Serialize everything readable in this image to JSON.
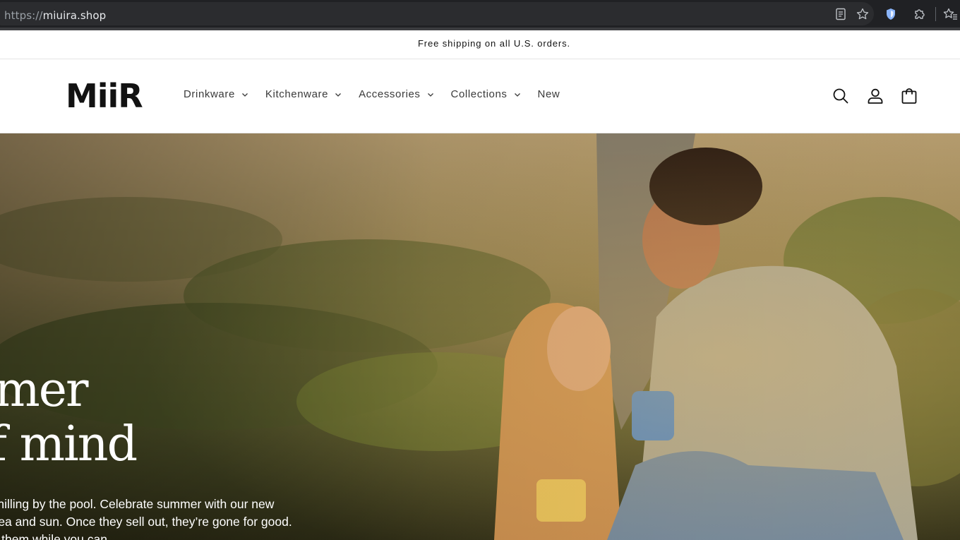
{
  "browser": {
    "url_scheme": "https://",
    "url_host": "miuira.shop"
  },
  "announcement": {
    "text": "Free shipping on all U.S. orders."
  },
  "header": {
    "logo": "MiiR",
    "nav": [
      {
        "label": "Drinkware",
        "has_dropdown": true
      },
      {
        "label": "Kitchenware",
        "has_dropdown": true
      },
      {
        "label": "Accessories",
        "has_dropdown": true
      },
      {
        "label": "Collections",
        "has_dropdown": true
      },
      {
        "label": "New",
        "has_dropdown": false
      }
    ],
    "icons": [
      "search-icon",
      "account-icon",
      "cart-icon"
    ]
  },
  "hero": {
    "heading_line1": "ummer",
    "heading_line2": "e of mind",
    "text_line1": "he beach. Chilling by the pool. Celebrate summer with our new",
    "text_line2": "ired by the sea and sun. Once they sell out, they’re gone for good.",
    "text_line3": "lways, catch them while you can."
  },
  "colors": {
    "chrome_bg": "#202124",
    "text_dark": "#121212",
    "hero_text": "#ffffff"
  }
}
